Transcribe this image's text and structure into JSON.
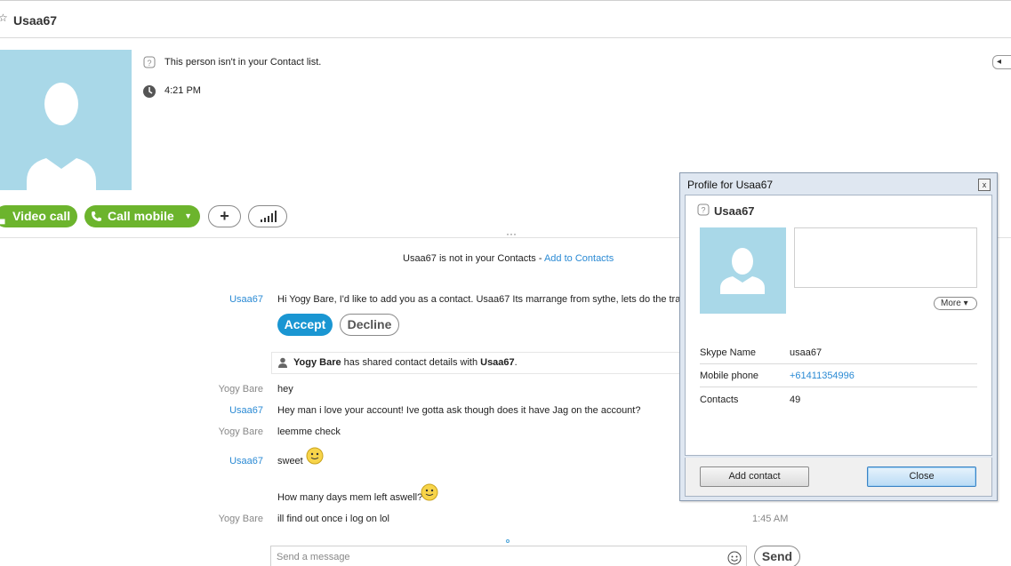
{
  "header": {
    "title": "Usaa67",
    "star_icon": "star-icon"
  },
  "profile": {
    "not_in_contacts": "This person isn't in your Contact list.",
    "local_time": "4:21 PM"
  },
  "actions": {
    "video_call": "Video call",
    "call_mobile": "Call mobile",
    "add": "+"
  },
  "chat": {
    "notice_text": "Usaa67 is not in your Contacts - ",
    "notice_link": "Add to Contacts",
    "request_sender": "Usaa67",
    "request_text": "Hi Yogy Bare, I'd like to add you as a contact. Usaa67  Its marrange from sythe, lets do the tra",
    "accept": "Accept",
    "decline": "Decline",
    "shared_prefix": "Yogy Bare",
    "shared_middle": " has shared contact details with ",
    "shared_target": "Usaa67",
    "shared_suffix": ".",
    "messages": [
      {
        "sender": "Yogy Bare",
        "text": "hey",
        "time": ""
      },
      {
        "sender": "Usaa67",
        "text": "Hey man i love your account! Ive gotta ask though does it have Jag on the account?",
        "time": ""
      },
      {
        "sender": "Yogy Bare",
        "text": "leemme check",
        "time": ""
      },
      {
        "sender": "Usaa67",
        "text": "sweet",
        "time": ""
      },
      {
        "sender": "",
        "text": "How many days mem left aswell?",
        "time": ""
      },
      {
        "sender": "Yogy Bare",
        "text": "ill find out once i log on lol",
        "time": "1:45 AM"
      }
    ]
  },
  "compose": {
    "placeholder": "Send a message",
    "send": "Send"
  },
  "dialog": {
    "title": "Profile for Usaa67",
    "close_x": "x",
    "name": "Usaa67",
    "more": "More",
    "fields": [
      {
        "key": "Skype Name",
        "value": "usaa67"
      },
      {
        "key": "Mobile phone",
        "value": "+61411354996"
      },
      {
        "key": "Contacts",
        "value": "49"
      }
    ],
    "add_contact": "Add contact",
    "close": "Close"
  },
  "colors": {
    "accent_green": "#6cb42d",
    "accent_blue": "#1a96d2",
    "link_blue": "#2a8ad4",
    "avatar_bg": "#a9d8e8"
  }
}
